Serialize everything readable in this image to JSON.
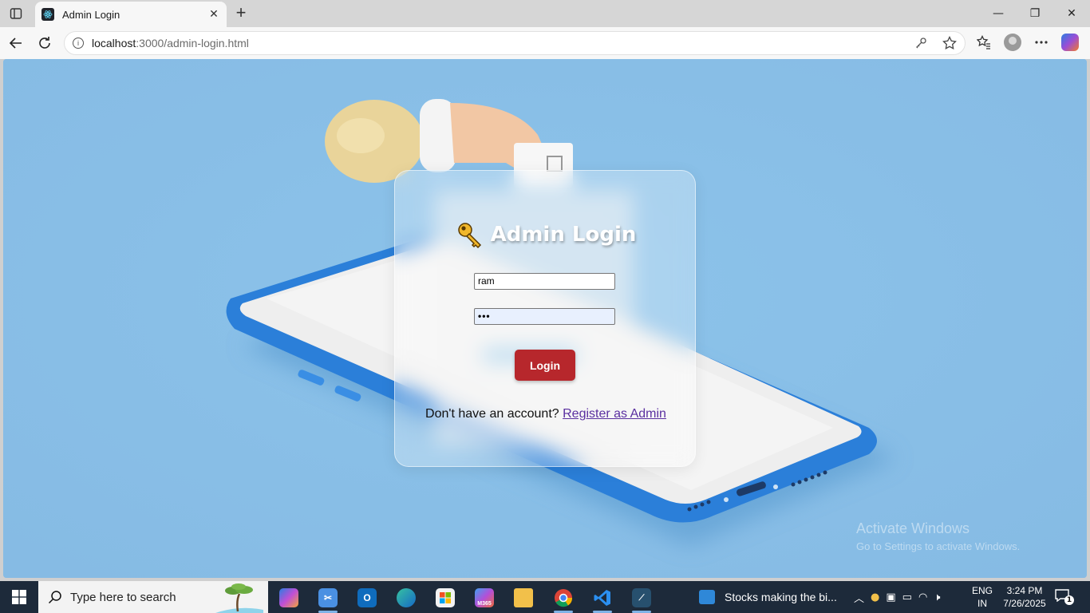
{
  "browser": {
    "tab_title": "Admin Login",
    "new_tab_symbol": "+",
    "url_host": "localhost",
    "url_rest": ":3000/admin-login.html",
    "window_controls": {
      "minimize": "—",
      "restore": "❐",
      "close": "✕"
    },
    "tab_close": "✕"
  },
  "page": {
    "title": "Admin Login",
    "username_value": "ram",
    "password_value": "•••",
    "login_label": "Login",
    "register_prompt": "Don't have an account? ",
    "register_link": "Register as Admin",
    "accent_color": "#b7272c",
    "background_color": "#88bde6"
  },
  "watermark": {
    "line1": "Activate Windows",
    "line2": "Go to Settings to activate Windows."
  },
  "taskbar": {
    "search_placeholder": "Type here to search",
    "news_text": "Stocks making the bi...",
    "m365_label": "M365",
    "lang_top": "ENG",
    "lang_bottom": "IN",
    "time": "3:24 PM",
    "date": "7/26/2025",
    "notification_count": "1",
    "apps": [
      "copilot",
      "snipping-tool",
      "outlook",
      "edge",
      "microsoft-store",
      "m365",
      "file-explorer",
      "chrome",
      "vscode",
      "mysql-workbench"
    ]
  }
}
